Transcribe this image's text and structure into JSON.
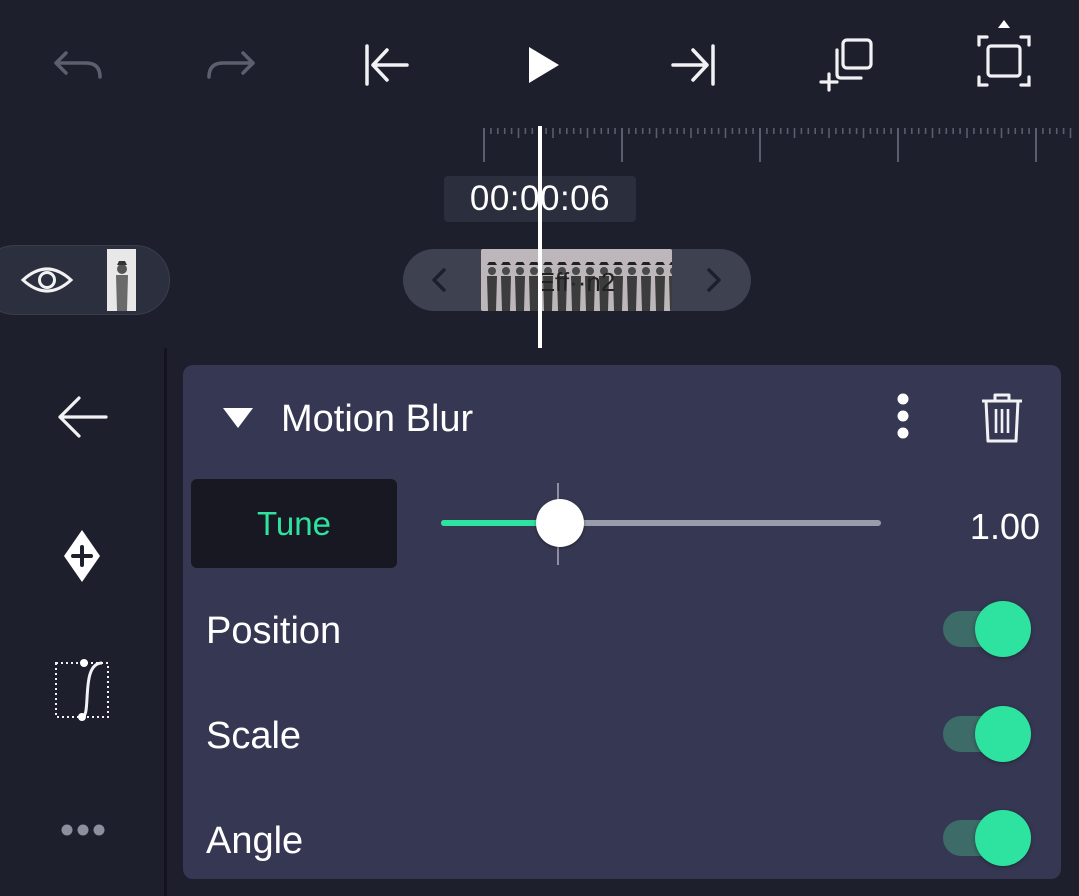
{
  "toolbar": {
    "undo_icon": "undo-icon",
    "redo_icon": "redo-icon",
    "skip_start_icon": "skip-to-start-icon",
    "play_icon": "play-icon",
    "skip_end_icon": "skip-to-end-icon",
    "add_copy_icon": "add-copy-icon",
    "fullscreen_icon": "fullscreen-icon"
  },
  "timeline": {
    "timecode": "00:00:06",
    "clip_label": "Eff··n2"
  },
  "sidebar": {
    "icons": [
      "back-arrow-icon",
      "add-keyframe-icon",
      "easing-curve-icon",
      "more-icon"
    ]
  },
  "effect": {
    "title": "Motion Blur",
    "tune_label": "Tune",
    "tune_value": "1.00",
    "tune_fraction": 0.27,
    "options": [
      {
        "label": "Position",
        "enabled": true
      },
      {
        "label": "Scale",
        "enabled": true
      },
      {
        "label": "Angle",
        "enabled": true
      }
    ]
  },
  "colors": {
    "accent": "#2ee39f",
    "background": "#1d1f2c",
    "panel": "#363853"
  }
}
